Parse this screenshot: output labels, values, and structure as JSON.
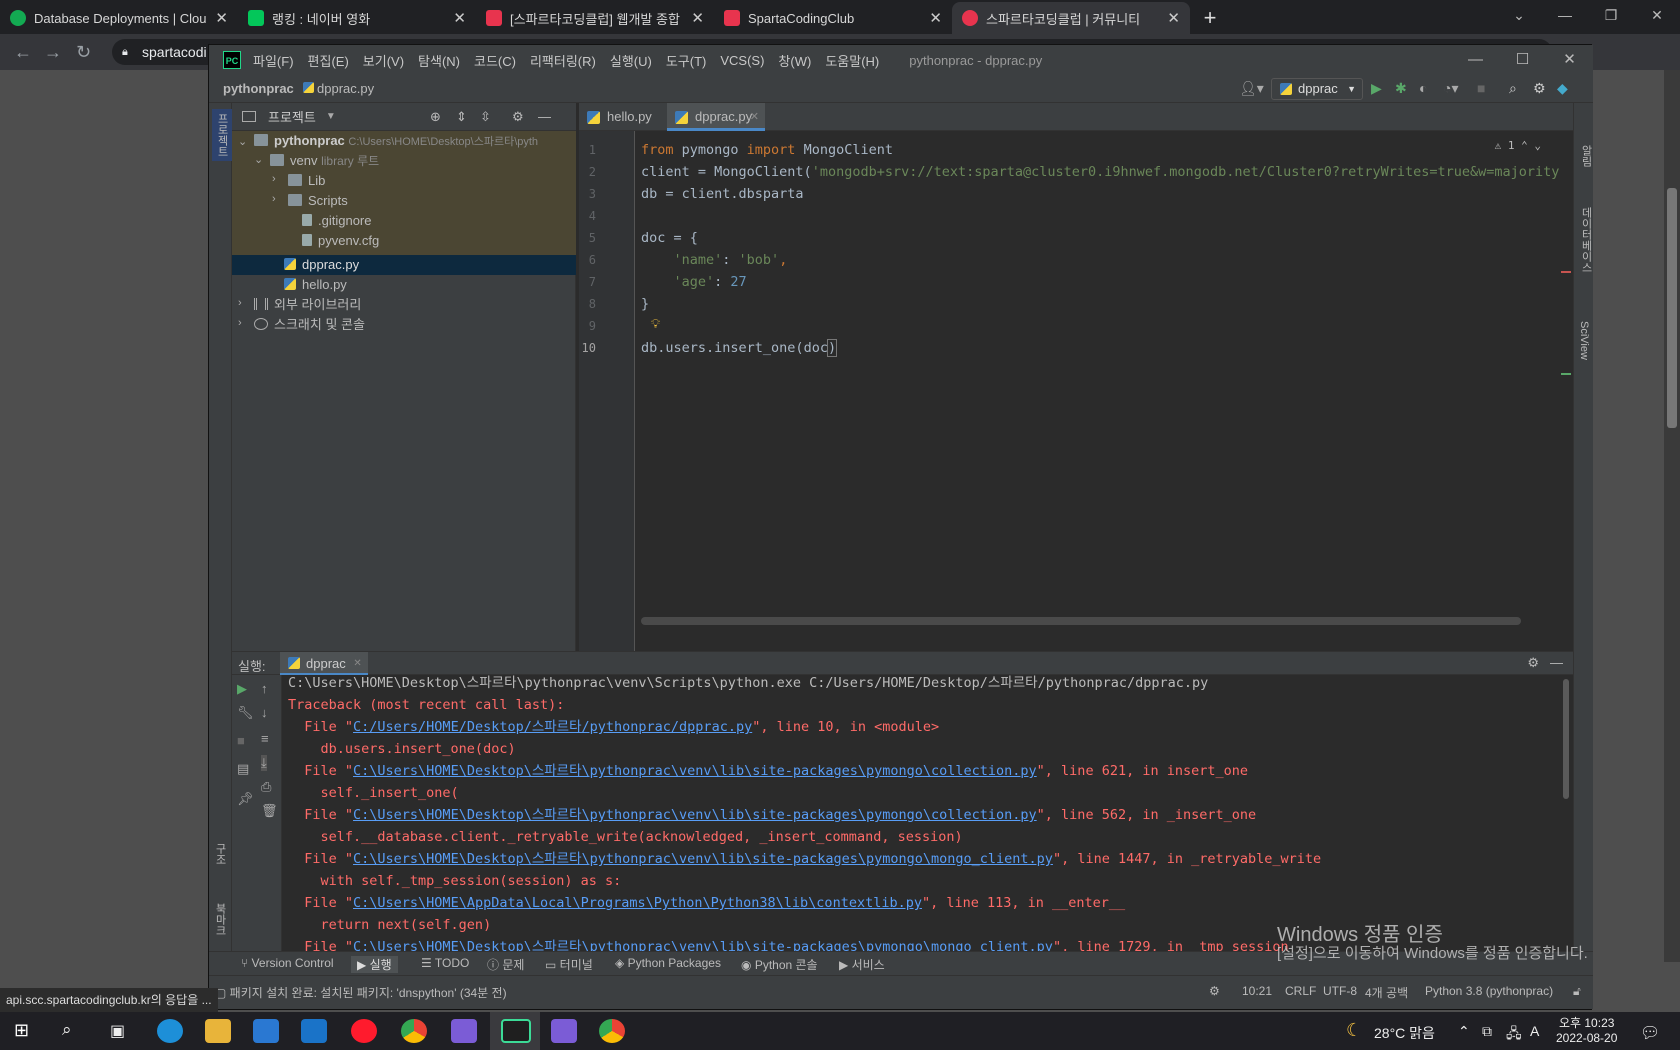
{
  "browser": {
    "tabs": [
      {
        "label": "Database Deployments | Cloud:",
        "color": "#13aa52"
      },
      {
        "label": "랭킹 : 네이버 영화",
        "color": "#03c75a"
      },
      {
        "label": "[스파르타코딩클럽] 웹개발 종합",
        "color": "#e8344e"
      },
      {
        "label": "SpartaCodingClub",
        "color": "#e8344e"
      },
      {
        "label": "스파르타코딩클럽 | 커뮤니티",
        "color": "#e8344e"
      }
    ],
    "url": "spartacodi",
    "status_url": "api.scc.spartacodingclub.kr의 응답을 ..."
  },
  "ide": {
    "logo": "PC",
    "menu": [
      "파일(F)",
      "편집(E)",
      "보기(V)",
      "탐색(N)",
      "코드(C)",
      "리팩터링(R)",
      "실행(U)",
      "도구(T)",
      "VCS(S)",
      "창(W)",
      "도움말(H)"
    ],
    "title": "pythonprac - dpprac.py",
    "breadcrumb": {
      "project": "pythonprac",
      "file": "dpprac.py"
    },
    "run_config": "dpprac",
    "left_stripe": {
      "project": "프로젝트",
      "structure": "구조",
      "bookmarks": "북마크"
    },
    "right_stripe": {
      "notifications": "알림",
      "database": "데이터베이스",
      "sciview": "SciView"
    },
    "project_panel": {
      "title": "프로젝트",
      "root": {
        "name": "pythonprac",
        "path": "C:\\Users\\HOME\\Desktop\\스파르타\\pyth"
      },
      "venv": {
        "name": "venv",
        "hint": "library 루트"
      },
      "items": [
        "Lib",
        "Scripts",
        ".gitignore",
        "pyvenv.cfg",
        "dpprac.py",
        "hello.py",
        "외부 라이브러리",
        "스크래치 및 콘솔"
      ]
    },
    "editor": {
      "tabs": [
        "hello.py",
        "dpprac.py"
      ],
      "warnings": "1",
      "lines": [
        "1",
        "2",
        "3",
        "4",
        "5",
        "6",
        "7",
        "8",
        "9",
        "10"
      ],
      "code": {
        "l1a": "from",
        "l1b": " pymongo ",
        "l1c": "import",
        "l1d": " MongoClient",
        "l2a": "client = MongoClient(",
        "l2b": "'mongodb+srv://text:sparta@cluster0.i9hnwef.mongodb.net/Cluster0?retryWrites=true&w=majority'",
        "l2c": ")",
        "l3": "db = client.dbsparta",
        "l5": "doc = {",
        "l6a": "    'name'",
        "l6b": ": ",
        "l6c": "'bob'",
        "l6d": ",",
        "l7a": "    'age'",
        "l7b": ": ",
        "l7c": "27",
        "l8": "}",
        "l10a": "db.users.insert_one(",
        "l10b": "doc",
        "l10c": ")"
      }
    },
    "run": {
      "label": "실행:",
      "tab": "dpprac",
      "output": {
        "cmd": "C:\\Users\\HOME\\Desktop\\스파르타\\pythonprac\\venv\\Scripts\\python.exe C:/Users/HOME/Desktop/스파르타/pythonprac/dpprac.py",
        "tb": "Traceback (most recent call last):",
        "f1a": "  File \"",
        "f1b": "C:/Users/HOME/Desktop/스파르타/pythonprac/dpprac.py",
        "f1c": "\", line 10, in <module>",
        "s1": "    db.users.insert_one(doc)",
        "f2a": "  File \"",
        "f2b": "C:\\Users\\HOME\\Desktop\\스파르타\\pythonprac\\venv\\lib\\site-packages\\pymongo\\collection.py",
        "f2c": "\", line 621, in insert_one",
        "s2": "    self._insert_one(",
        "f3a": "  File \"",
        "f3b": "C:\\Users\\HOME\\Desktop\\스파르타\\pythonprac\\venv\\lib\\site-packages\\pymongo\\collection.py",
        "f3c": "\", line 562, in _insert_one",
        "s3": "    self.__database.client._retryable_write(acknowledged, _insert_command, session)",
        "f4a": "  File \"",
        "f4b": "C:\\Users\\HOME\\Desktop\\스파르타\\pythonprac\\venv\\lib\\site-packages\\pymongo\\mongo_client.py",
        "f4c": "\", line 1447, in _retryable_write",
        "s4": "    with self._tmp_session(session) as s:",
        "f5a": "  File \"",
        "f5b": "C:\\Users\\HOME\\AppData\\Local\\Programs\\Python\\Python38\\lib\\contextlib.py",
        "f5c": "\", line 113, in __enter__",
        "s5": "    return next(self.gen)",
        "f6a": "  File \"",
        "f6b": "C:\\Users\\HOME\\Desktop\\스파르타\\pythonprac\\venv\\lib\\site-packages\\pymongo\\mongo_client.py",
        "f6c": "\", line 1729, in _tmp_session"
      }
    },
    "bottom_tools": [
      "Version Control",
      "실행",
      "TODO",
      "문제",
      "터미널",
      "Python Packages",
      "Python 콘솔",
      "서비스"
    ],
    "status": {
      "message": "패키지 설치 완료: 설치된 패키지: 'dnspython' (34분 전)",
      "position": "10:21",
      "line_sep": "CRLF",
      "encoding": "UTF-8",
      "indent": "4개 공백",
      "interpreter": "Python 3.8 (pythonprac)"
    }
  },
  "watermark": {
    "title": "Windows 정품 인증",
    "subtitle": "[설정]으로 이동하여 Windows를 정품 인증합니다."
  },
  "taskbar": {
    "weather": "28°C  맑음",
    "time": "오후 10:23",
    "date": "2022-08-20",
    "ime": "A"
  }
}
